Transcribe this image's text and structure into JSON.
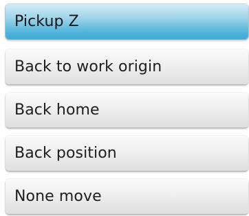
{
  "menu": {
    "items": [
      {
        "label": "Pickup Z",
        "selected": true
      },
      {
        "label": "Back to work origin",
        "selected": false
      },
      {
        "label": "Back home",
        "selected": false
      },
      {
        "label": "Back position",
        "selected": false
      },
      {
        "label": "None move",
        "selected": false
      }
    ]
  },
  "colors": {
    "selected_accent": "#52b4dc",
    "button_base": "#efefef",
    "text": "#1d1d1d"
  }
}
